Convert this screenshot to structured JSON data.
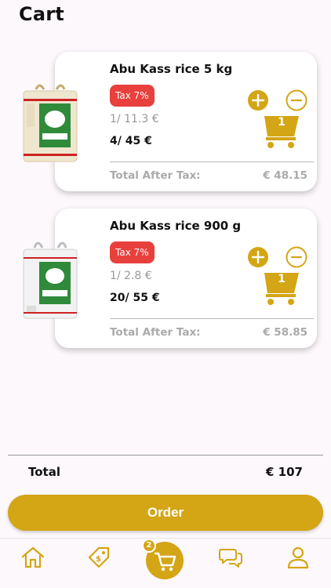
{
  "header": {
    "title": "Cart"
  },
  "items": [
    {
      "name": "Abu Kass rice 5 kg",
      "tax_label": "Tax 7%",
      "unit_price": "1/ 11.3 €",
      "pack_price": "4/ 45 €",
      "tat_label": "Total After Tax:",
      "tat_value": "€ 48.15",
      "quantity": "1"
    },
    {
      "name": "Abu Kass rice 900 g",
      "tax_label": "Tax 7%",
      "unit_price": "1/ 2.8 €",
      "pack_price": "20/ 55 €",
      "tat_label": "Total After Tax:",
      "tat_value": "€ 58.85",
      "quantity": "1"
    }
  ],
  "summary": {
    "total_label": "Total",
    "total_value": "€ 107"
  },
  "order": {
    "label": "Order"
  },
  "nav": {
    "cart_badge": "2",
    "icons": [
      "home-icon",
      "tag-icon",
      "cart-icon",
      "chat-icon",
      "user-icon"
    ]
  },
  "colors": {
    "accent": "#d4a514",
    "tax_badge": "#e8403c",
    "muted": "#999999"
  }
}
